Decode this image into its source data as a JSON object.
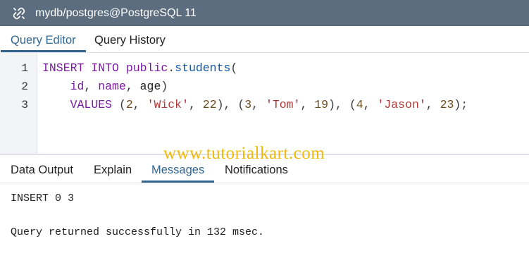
{
  "window": {
    "title": "mydb/postgres@PostgreSQL 11",
    "icon": "connection-link-icon"
  },
  "top_tabs": [
    {
      "label": "Query Editor",
      "active": true
    },
    {
      "label": "Query History",
      "active": false
    }
  ],
  "editor": {
    "line_numbers": [
      "1",
      "2",
      "3"
    ],
    "line1": {
      "kw1": "INSERT",
      "kw2": "INTO",
      "kw3": "public",
      "dot": ".",
      "table": "students",
      "paren": "("
    },
    "line2": {
      "indent": "    ",
      "col1": "id",
      "comma1": ", ",
      "col2": "name",
      "comma2": ", ",
      "col3": "age",
      "paren": ")"
    },
    "line3": {
      "indent": "    ",
      "kw": "VALUES",
      "sp": " ",
      "o1": "(",
      "n1": "2",
      "c1": ", ",
      "s1": "'Wick'",
      "c2": ", ",
      "n2": "22",
      "e1": "), ",
      "o2": "(",
      "n3": "3",
      "c3": ", ",
      "s2": "'Tom'",
      "c4": ", ",
      "n4": "19",
      "e2": "), ",
      "o3": "(",
      "n5": "4",
      "c5": ", ",
      "s3": "'Jason'",
      "c6": ", ",
      "n6": "23",
      "e3": ");"
    }
  },
  "watermark": "www.tutorialkart.com",
  "bottom_tabs": [
    {
      "label": "Data Output",
      "active": false
    },
    {
      "label": "Explain",
      "active": false
    },
    {
      "label": "Messages",
      "active": true
    },
    {
      "label": "Notifications",
      "active": false
    }
  ],
  "messages": {
    "line1": "INSERT 0 3",
    "line2": "Query returned successfully in 132 msec."
  },
  "colors": {
    "titlebar": "#5b6d7f",
    "active_tab": "#326690",
    "keyword": "#7d1ba8",
    "identifier": "#0f56a8",
    "number": "#6b4c1d",
    "string": "#b33a3a",
    "watermark": "#f2b90a"
  }
}
